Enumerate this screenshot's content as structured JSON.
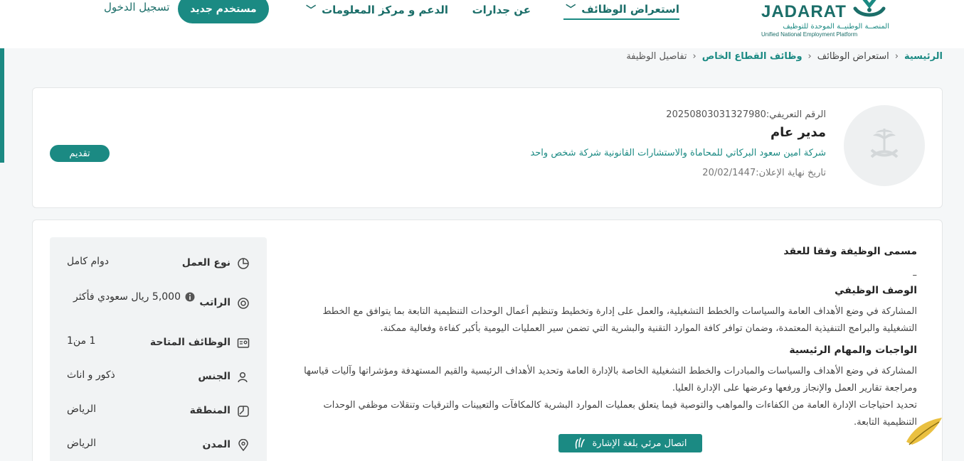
{
  "header": {
    "logo_text": "JADARAT",
    "logo_ar": "المنصــة الوطنيــة الموحدة للتوظيف",
    "logo_en": "Unified National Employment Platform",
    "nav": {
      "browse_jobs": "استعراض الوظائف",
      "about": "عن جدارات",
      "support": "الدعم و مركز المعلومات"
    },
    "new_user": "مستخدم جديد",
    "login": "تسجيل الدخول"
  },
  "breadcrumb": {
    "home": "الرئيسية",
    "browse": "استعراض الوظائف",
    "private": "وظائف القطاع الخاص",
    "current": "تفاصيل الوظيفة"
  },
  "job": {
    "ref": "الرقم التعريفي:20250803031327980",
    "title": "مدير عام",
    "company": "شركة امين سعود البركاتي للمحاماة والاستشارات القانونية شركة شخص واحد",
    "deadline": "تاريخ نهاية الإعلان:20/02/1447",
    "apply_label": "تقديم"
  },
  "details": [
    {
      "icon": "pie-chart-icon",
      "label": "نوع العمل",
      "value": "دوام كامل"
    },
    {
      "icon": "money-icon",
      "label": "الراتب",
      "value": "5,000 ريال سعودي فأكثر"
    },
    {
      "icon": "id-card-icon",
      "label": "الوظائف المتاحة",
      "value": "1 من1"
    },
    {
      "icon": "person-icon",
      "label": "الجنس",
      "value": "ذكور و اناث"
    },
    {
      "icon": "map-icon",
      "label": "المنطقة",
      "value": "الرياض"
    },
    {
      "icon": "location-pin-icon",
      "label": "المدن",
      "value": "الرياض"
    }
  ],
  "content": {
    "contract_title_heading": "مسمى الوظيفة وفقا للعقد",
    "contract_title_value": "–",
    "description_heading": "الوصف الوظيفي",
    "description": "المشاركة في وضع الأهداف العامة والسياسات والخطط التشغيلية، والعمل على إدارة وتخطيط وتنظيم أعمال الوحدات التنظيمية التابعة بما يتوافق مع الخطط التشغيلية والبرامج التنفيذية المعتمدة، وضمان توافر كافة الموارد التقنية والبشرية التي تضمن سير العمليات اليومية بأكبر كفاءة وفعالية ممكنة.",
    "duties_heading": "الواجبات والمهام الرئيسية",
    "duty1": "المشاركة في وضع الأهداف والسياسات والمبادرات والخطط التشغيلية الخاصة بالإدارة العامة وتحديد الأهداف الرئيسية والقيم المستهدفة ومؤشراتها وآليات قياسها ومراجعة تقارير العمل والإنجاز ورفعها وعرضها على الإدارة العليا.",
    "duty2": "تحديد احتياجات الإدارة العامة من الكفاءات والمواهب والتوصية فيما يتعلق بعمليات الموارد البشرية كالمكافآت والتعيينات والترقيات وتنقلات موظفي الوحدات التنظيمية التابعة."
  },
  "sign_language": "اتصال مرئي بلغة الإشارة",
  "colors": {
    "primary": "#1b8a83",
    "dark": "#1b6e69"
  }
}
